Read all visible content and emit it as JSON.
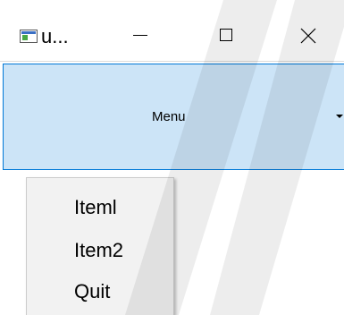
{
  "window": {
    "title": "u...",
    "icon": "app-window-icon",
    "controls": {
      "minimize_icon": "minimize-icon",
      "maximize_icon": "maximize-icon",
      "close_icon": "close-icon"
    }
  },
  "menu_button": {
    "label": "Menu",
    "arrow_icon": "dropdown-arrow-icon",
    "background": "#cce4f7",
    "border": "#0078d7"
  },
  "dropdown": {
    "items": [
      {
        "label": "Iteml"
      },
      {
        "label": "Item2"
      },
      {
        "label": "Quit"
      }
    ],
    "background": "#f2f2f2"
  }
}
